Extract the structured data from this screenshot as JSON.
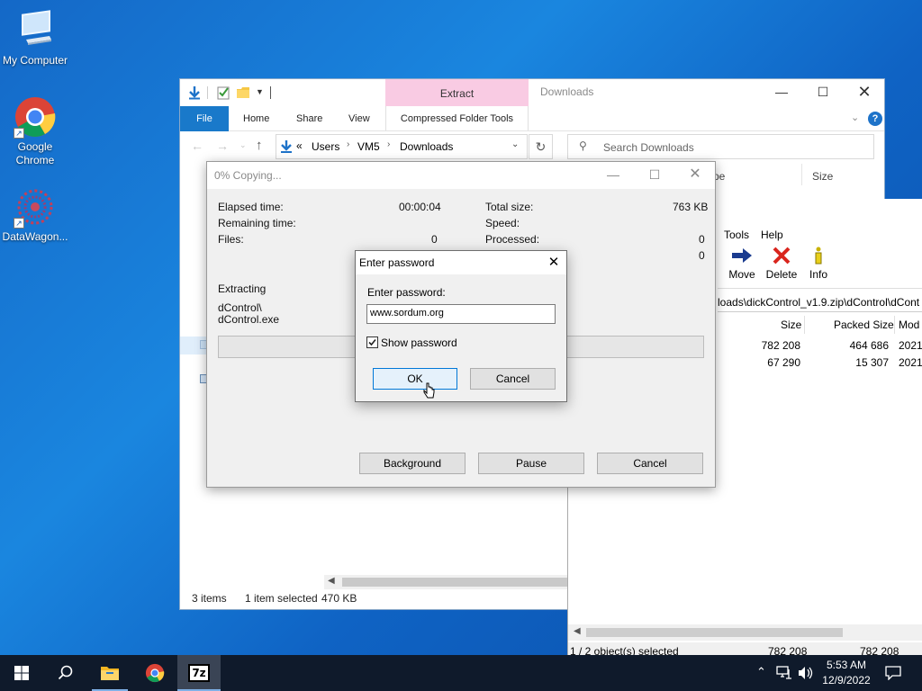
{
  "desktop": {
    "icons": [
      {
        "label": "My Computer"
      },
      {
        "label": "Google Chrome"
      },
      {
        "label": "DataWagon..."
      }
    ]
  },
  "explorer": {
    "title": "Downloads",
    "contextual_tab_group": "Extract",
    "tabs": {
      "file": "File",
      "home": "Home",
      "share": "Share",
      "view": "View",
      "compressed": "Compressed Folder Tools"
    },
    "breadcrumb": {
      "overflow": "«",
      "items": [
        "Users",
        "VM5",
        "Downloads"
      ]
    },
    "search_placeholder": "Search Downloads",
    "columns": {
      "type": "pe",
      "size": "Size"
    },
    "status": {
      "items": "3 items",
      "selected": "1 item selected",
      "size": "470 KB"
    }
  },
  "sevenzip": {
    "menu": {
      "tools": "Tools",
      "help": "Help"
    },
    "toolbar": {
      "move": "Move",
      "delete": "Delete",
      "info": "Info"
    },
    "path": "loads\\dickControl_v1.9.zip\\dControl\\dCont",
    "columns": {
      "size": "Size",
      "packed": "Packed Size",
      "modified": "Mod"
    },
    "rows": [
      {
        "size": "782 208",
        "packed": "464 686",
        "modified": "2021-"
      },
      {
        "size": "67 290",
        "packed": "15 307",
        "modified": "2021-"
      }
    ],
    "status": {
      "selected": "1 / 2 object(s) selected",
      "size": "782 208",
      "packed": "782 208"
    }
  },
  "copy_dialog": {
    "title": "0% Copying...",
    "elapsed_label": "Elapsed time:",
    "elapsed_value": "00:00:04",
    "remaining_label": "Remaining time:",
    "files_label": "Files:",
    "files_value": "0",
    "total_label": "Total size:",
    "total_value": "763 KB",
    "speed_label": "Speed:",
    "processed_label": "Processed:",
    "processed_value": "0",
    "extra_value": "0",
    "action": "Extracting",
    "path_line1": "dControl\\",
    "path_line2": "dControl.exe",
    "buttons": {
      "background": "Background",
      "pause": "Pause",
      "cancel": "Cancel"
    }
  },
  "password_dialog": {
    "title": "Enter password",
    "prompt": "Enter password:",
    "value": "www.sordum.org",
    "show_password": "Show password",
    "show_password_checked": true,
    "ok": "OK",
    "cancel": "Cancel"
  },
  "taskbar": {
    "time": "5:53 AM",
    "date": "12/9/2022",
    "pinned": [
      "start-button",
      "search-button",
      "file-explorer",
      "chrome",
      "7zip"
    ]
  }
}
